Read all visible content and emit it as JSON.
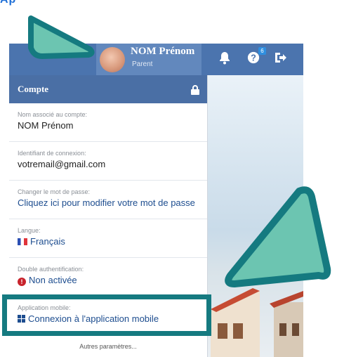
{
  "header_word": "Ap",
  "topbar": {
    "user_name": "NOM Prénom",
    "user_role": "Parent",
    "help_badge": "6"
  },
  "panel": {
    "title": "Compte",
    "rows": [
      {
        "label": "Nom associé au compte:",
        "value": "NOM Prénom"
      },
      {
        "label": "Identifiant de connexion:",
        "value": "votremail@gmail.com"
      },
      {
        "label": "Changer le mot de passe:",
        "value": "Cliquez ici pour modifier votre mot de passe"
      },
      {
        "label": "Langue:",
        "value": "Français"
      },
      {
        "label": "Double authentification:",
        "value": "Non activée"
      },
      {
        "label": "Application mobile:",
        "value": "Connexion à l'application mobile"
      }
    ],
    "more_link": "Autres paramètres..."
  },
  "colors": {
    "topbar": "#4b74ae",
    "panel_header": "#4a6fa5",
    "highlight": "#157a80",
    "arrow_fill": "#6cc5b1",
    "error_dot": "#c8232c"
  },
  "icons": [
    "bell-icon",
    "help-icon",
    "logout-icon",
    "lock-icon",
    "france-flag-icon",
    "warning-icon",
    "grid-icon"
  ]
}
